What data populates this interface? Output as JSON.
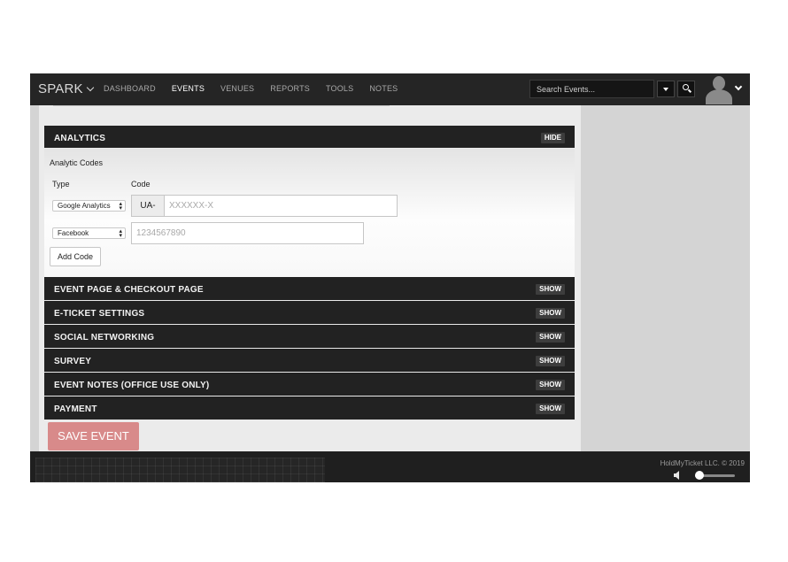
{
  "header": {
    "brand": "SPARK",
    "nav": [
      "DASHBOARD",
      "EVENTS",
      "VENUES",
      "REPORTS",
      "TOOLS",
      "NOTES"
    ],
    "active_nav": "EVENTS",
    "search_placeholder": "Search Events..."
  },
  "analytics": {
    "title": "ANALYTICS",
    "toggle": "HIDE",
    "codes_label": "Analytic Codes",
    "type_header": "Type",
    "code_header": "Code",
    "rows": [
      {
        "type": "Google Analytics",
        "prefix": "UA-",
        "placeholder": "XXXXXX-X",
        "value": ""
      },
      {
        "type": "Facebook",
        "prefix": "",
        "placeholder": "1234567890",
        "value": ""
      }
    ],
    "add_button": "Add Code"
  },
  "sections": [
    {
      "title": "EVENT PAGE & CHECKOUT PAGE",
      "toggle": "SHOW"
    },
    {
      "title": "E-TICKET SETTINGS",
      "toggle": "SHOW"
    },
    {
      "title": "SOCIAL NETWORKING",
      "toggle": "SHOW"
    },
    {
      "title": "SURVEY",
      "toggle": "SHOW"
    },
    {
      "title": "EVENT NOTES (OFFICE USE ONLY)",
      "toggle": "SHOW"
    },
    {
      "title": "PAYMENT",
      "toggle": "SHOW"
    }
  ],
  "save_button": "SAVE EVENT",
  "footer": {
    "copyright": "HoldMyTicket LLC. © 2019",
    "volume": 0.1
  },
  "colors": {
    "header_bg": "#252525",
    "section_bg": "#222222",
    "save_button_bg": "#d88a8a",
    "sidebar_bg": "#d4d4d4"
  }
}
